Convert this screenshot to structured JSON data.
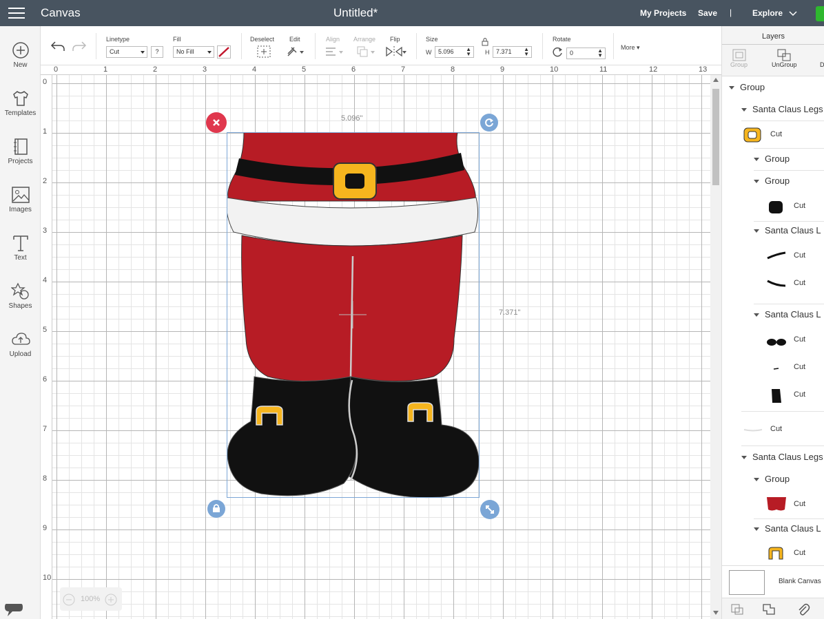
{
  "topbar": {
    "app_title": "Canvas",
    "doc_title": "Untitled*",
    "my_projects": "My Projects",
    "save": "Save",
    "separator": "|",
    "explore": "Explore"
  },
  "sidebar": {
    "items": [
      {
        "label": "New",
        "icon": "plus-circle-icon"
      },
      {
        "label": "Templates",
        "icon": "tshirt-icon"
      },
      {
        "label": "Projects",
        "icon": "notebook-icon"
      },
      {
        "label": "Images",
        "icon": "image-icon"
      },
      {
        "label": "Text",
        "icon": "text-icon"
      },
      {
        "label": "Shapes",
        "icon": "shapes-icon"
      },
      {
        "label": "Upload",
        "icon": "cloud-upload-icon"
      }
    ]
  },
  "toolbar": {
    "linetype_label": "Linetype",
    "linetype_value": "Cut",
    "help": "?",
    "fill_label": "Fill",
    "fill_value": "No Fill",
    "deselect_label": "Deselect",
    "edit_label": "Edit",
    "align_label": "Align",
    "arrange_label": "Arrange",
    "flip_label": "Flip",
    "size_label": "Size",
    "w_label": "W",
    "w_value": "5.096",
    "h_label": "H",
    "h_value": "7.371",
    "rotate_label": "Rotate",
    "rotate_value": "0",
    "more_label": "More"
  },
  "canvas": {
    "ruler_top": [
      "0",
      "1",
      "2",
      "3",
      "4",
      "5",
      "6",
      "7",
      "8",
      "9",
      "10",
      "11",
      "12",
      "13"
    ],
    "ruler_left": [
      "0",
      "1",
      "2",
      "3",
      "4",
      "5",
      "6",
      "7",
      "8",
      "9",
      "10"
    ],
    "width_label": "5.096\"",
    "height_label": "7.371\"",
    "zoom": "100%"
  },
  "layers_panel": {
    "title": "Layers",
    "group_btn": "Group",
    "ungroup_btn": "UnGroup",
    "detach_btn": "D",
    "rows": [
      {
        "label": "Group",
        "type": "group"
      },
      {
        "label": "Santa Claus Legs",
        "type": "group"
      },
      {
        "label": "Cut",
        "type": "item"
      },
      {
        "label": "Group",
        "type": "group"
      },
      {
        "label": "Group",
        "type": "group"
      },
      {
        "label": "Cut",
        "type": "item"
      },
      {
        "label": "Santa Claus L",
        "type": "group"
      },
      {
        "label": "Cut",
        "type": "item"
      },
      {
        "label": "Cut",
        "type": "item"
      },
      {
        "label": "Santa Claus L",
        "type": "group"
      },
      {
        "label": "Cut",
        "type": "item"
      },
      {
        "label": "Cut",
        "type": "item"
      },
      {
        "label": "Cut",
        "type": "item"
      },
      {
        "label": "Cut",
        "type": "item"
      },
      {
        "label": "Santa Claus Legs",
        "type": "group"
      },
      {
        "label": "Group",
        "type": "group"
      },
      {
        "label": "Cut",
        "type": "item"
      },
      {
        "label": "Santa Claus L",
        "type": "group"
      },
      {
        "label": "Cut",
        "type": "item"
      }
    ],
    "blank_canvas": "Blank Canvas"
  },
  "colors": {
    "topbar": "#485460",
    "santa_red": "#b71c25",
    "buckle_gold": "#f6b51e",
    "delete_red": "#e0374d",
    "handle_blue": "#7ba6d6",
    "green": "#2eb82e"
  }
}
